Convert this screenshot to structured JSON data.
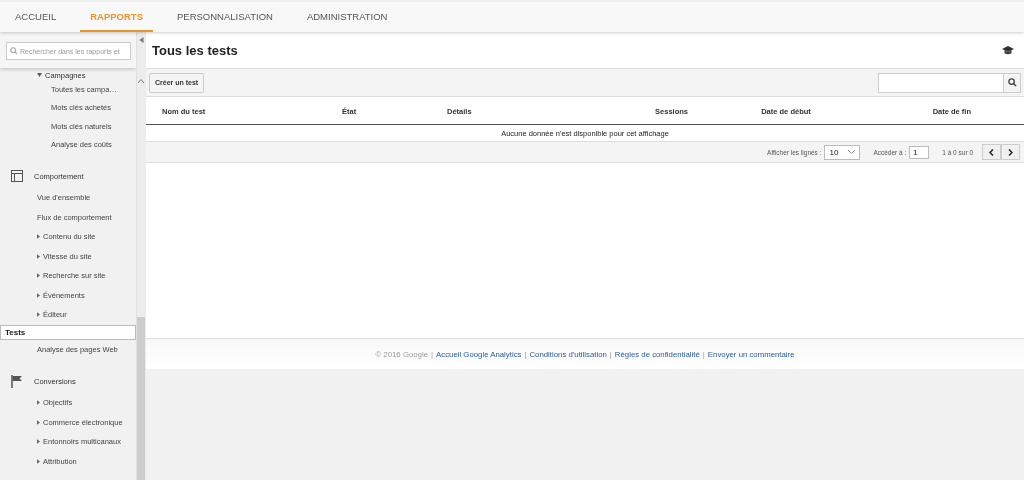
{
  "top_tabs": [
    {
      "label": "ACCUEIL",
      "selected": false
    },
    {
      "label": "RAPPORTS",
      "selected": true
    },
    {
      "label": "PERSONNALISATION",
      "selected": false
    },
    {
      "label": "ADMINISTRATION",
      "selected": false
    }
  ],
  "sidebar": {
    "search": {
      "placeholder": "Rechercher dans les rapports et"
    },
    "subsection": {
      "label": "Campagnes",
      "expanded": true,
      "children": [
        {
          "label": "Toutes les campa…",
          "selected": false
        },
        {
          "label": "Mots clés achetés",
          "selected": false
        },
        {
          "label": "Mots clés naturels",
          "selected": false
        },
        {
          "label": "Analyse des coûts",
          "selected": false
        }
      ]
    },
    "sections": [
      {
        "label": "Comportement",
        "children": [
          {
            "label": "Vue d'ensemble",
            "expandable": false,
            "selected": false
          },
          {
            "label": "Flux de comportement",
            "expandable": false,
            "selected": false
          },
          {
            "label": "Contenu du site",
            "expandable": true,
            "selected": false
          },
          {
            "label": "Vitesse du site",
            "expandable": true,
            "selected": false
          },
          {
            "label": "Recherche sur site",
            "expandable": true,
            "selected": false
          },
          {
            "label": "Événements",
            "expandable": true,
            "selected": false
          },
          {
            "label": "Éditeur",
            "expandable": true,
            "selected": false
          },
          {
            "label": "Tests",
            "expandable": false,
            "selected": true
          },
          {
            "label": "Analyse des pages Web",
            "expandable": false,
            "selected": false
          }
        ]
      },
      {
        "label": "Conversions",
        "children": [
          {
            "label": "Objectifs",
            "expandable": true,
            "selected": false
          },
          {
            "label": "Commerce électronique",
            "expandable": true,
            "selected": false
          },
          {
            "label": "Entonnoirs multicanaux",
            "expandable": true,
            "selected": false
          },
          {
            "label": "Attribution",
            "expandable": true,
            "selected": false
          }
        ]
      }
    ]
  },
  "page": {
    "title": "Tous les tests",
    "create_button": "Créer un test",
    "table": {
      "columns": [
        "Nom du test",
        "État",
        "Détails",
        "Sessions",
        "Date de début",
        "Date de fin"
      ],
      "empty_message": "Aucune donnée n'est disponible pour cet affichage"
    },
    "pager": {
      "rows_label": "Afficher les lignes :",
      "rows_value": "10",
      "goto_label": "Accéder à :",
      "goto_value": "1",
      "range": "1 à 0 sur 0"
    }
  },
  "footer": {
    "copyright": "© 2016 Google",
    "separator": "|",
    "links": [
      "Accueil Google Analytics",
      "Conditions d'utilisation",
      "Règles de confidentialité",
      "Envoyer un commentaire"
    ]
  }
}
